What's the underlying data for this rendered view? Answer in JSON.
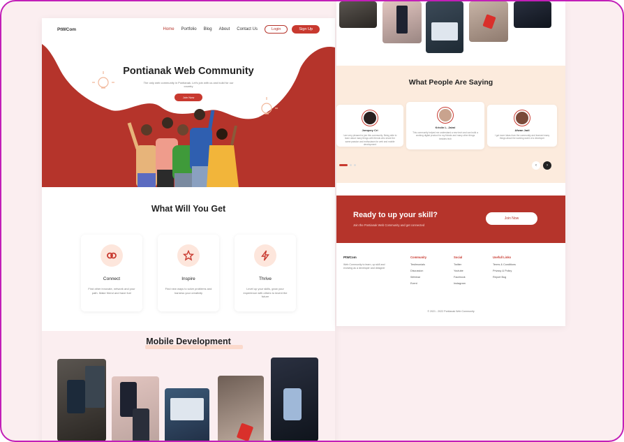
{
  "nav": {
    "logo": "PtWCom",
    "links": [
      "Home",
      "Portfolio",
      "Blog",
      "About",
      "Contact Us"
    ],
    "login": "Login",
    "signup": "Sign Up"
  },
  "hero": {
    "title": "Pontianak Web Community",
    "subtitle": "The only web community in Pontianak. Let's join with us and build for our country",
    "button": "Join Now"
  },
  "features": {
    "title": "What Will You Get",
    "cards": [
      {
        "title": "Connect",
        "desc": "Find other innovate, network and your path. Make friend and have fun!",
        "icon": "link-icon"
      },
      {
        "title": "Inspire",
        "desc": "Find new ways to solve problems and harness your creativity",
        "icon": "star-icon"
      },
      {
        "title": "Thrive",
        "desc": "Level up your skills, grow your experience with others to invent the future",
        "icon": "lightning-icon"
      }
    ]
  },
  "mobile": {
    "title": "Mobile Development"
  },
  "testimonials": {
    "title": "What People Are Saying",
    "items": [
      {
        "name": "Jonquey Cri",
        "text": "I am very pleased to join this community. Being able to learn about many things with friends who share the same passion and enthusiasm for web and mobile development"
      },
      {
        "name": "Kristin L. Jaimi",
        "text": "This community helped me understand a new tech and can build a working digital product for my friends and many other things besides tech"
      },
      {
        "name": "Afwan Jadi",
        "text": "I got more ideas from the community and learned many things about the working world of a developer"
      }
    ]
  },
  "cta": {
    "title": "Ready to up your skill?",
    "subtitle": "Join the Pontianak Web Community and get connected",
    "button": "Join Now"
  },
  "footer": {
    "brand": "PtWCom",
    "desc": "Web Community to learn, up skill and evolving as a developer and designer",
    "columns": [
      {
        "heading": "Community",
        "items": [
          "Testimonials",
          "Discussion",
          "Webinar",
          "Event"
        ]
      },
      {
        "heading": "Social",
        "items": [
          "Twitter",
          "Youtube",
          "Facebook",
          "Instagram"
        ]
      },
      {
        "heading": "Usefull Links",
        "items": [
          "Terms & Conditions",
          "Privacy & Policy",
          "Report Bug"
        ]
      }
    ],
    "copyright": "2021 - 2022 Pontianak Web Community"
  },
  "colors": {
    "brand": "#b5342b",
    "accent": "#c8392f",
    "soft": "#fcebdd",
    "frame": "#c21fb8"
  }
}
